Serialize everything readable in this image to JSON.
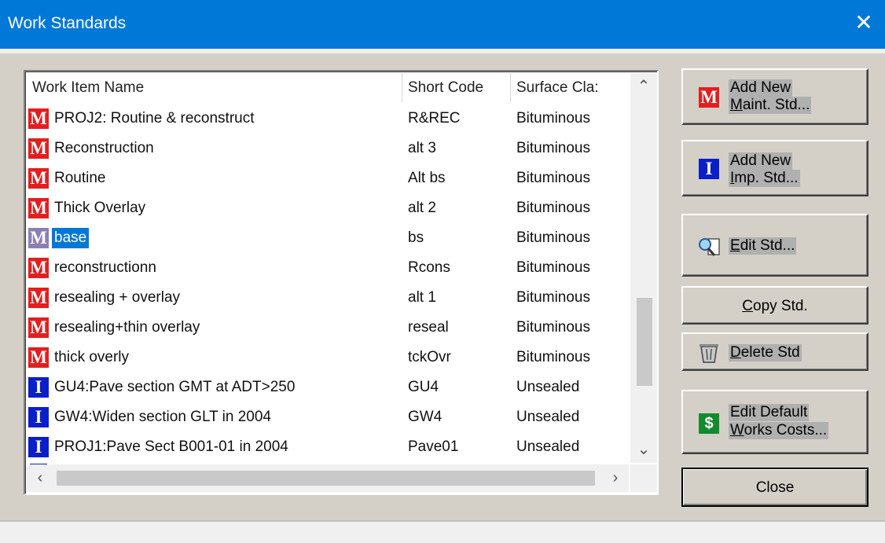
{
  "window": {
    "title": "Work Standards",
    "close_glyph": "✕"
  },
  "list": {
    "columns": [
      "Work Item Name",
      "Short Code",
      "Surface Cla:"
    ],
    "rows": [
      {
        "type": "M",
        "name": "PROJ2: Routine & reconstruct",
        "code": "R&REC",
        "surface": "Bituminous"
      },
      {
        "type": "M",
        "name": "Reconstruction",
        "code": "alt 3",
        "surface": "Bituminous"
      },
      {
        "type": "M",
        "name": "Routine",
        "code": "Alt bs",
        "surface": "Bituminous"
      },
      {
        "type": "M",
        "name": "Thick Overlay",
        "code": "alt 2",
        "surface": "Bituminous"
      },
      {
        "type": "M",
        "name": "base",
        "code": "bs",
        "surface": "Bituminous",
        "selected": true
      },
      {
        "type": "M",
        "name": "reconstructionn",
        "code": "Rcons",
        "surface": "Bituminous"
      },
      {
        "type": "M",
        "name": "resealing + overlay",
        "code": "alt 1",
        "surface": "Bituminous"
      },
      {
        "type": "M",
        "name": "resealing+thin overlay",
        "code": "reseal",
        "surface": "Bituminous"
      },
      {
        "type": "M",
        "name": "thick overly",
        "code": "tckOvr",
        "surface": "Bituminous"
      },
      {
        "type": "I",
        "name": "GU4:Pave section GMT at ADT>250",
        "code": "GU4",
        "surface": "Unsealed"
      },
      {
        "type": "I",
        "name": "GW4:Widen section GLT in 2004",
        "code": "GW4",
        "surface": "Unsealed"
      },
      {
        "type": "I",
        "name": "PROJ1:Pave Sect B001-01 in 2004",
        "code": "Pave01",
        "surface": "Unsealed"
      }
    ],
    "scroll_up": "⌃",
    "scroll_down": "⌄",
    "scroll_left": "‹",
    "scroll_right": "›"
  },
  "buttons": {
    "add_maint": {
      "icon": "M",
      "line1": "Add New",
      "line2_u": "M",
      "line2": "aint. Std..."
    },
    "add_imp": {
      "icon": "I",
      "line1": "Add New",
      "line2_u": "I",
      "line2": "mp. Std..."
    },
    "edit_std": {
      "icon": "magnify-icon",
      "label_u": "E",
      "label": "dit Std..."
    },
    "copy_std": {
      "label_u": "C",
      "label": "opy Std."
    },
    "delete_std": {
      "icon": "trash-icon",
      "label_u": "D",
      "label": "elete Std"
    },
    "edit_costs": {
      "icon": "$",
      "line1": "Edit Default",
      "line2_u": "W",
      "line2": "orks Costs..."
    },
    "close": {
      "label": "Close"
    }
  },
  "colors": {
    "titlebar": "#0078d7",
    "maint_icon": "#e31e1e",
    "imp_icon": "#0a1fc8",
    "cost_icon": "#138a2d",
    "selection": "#0078d7"
  }
}
